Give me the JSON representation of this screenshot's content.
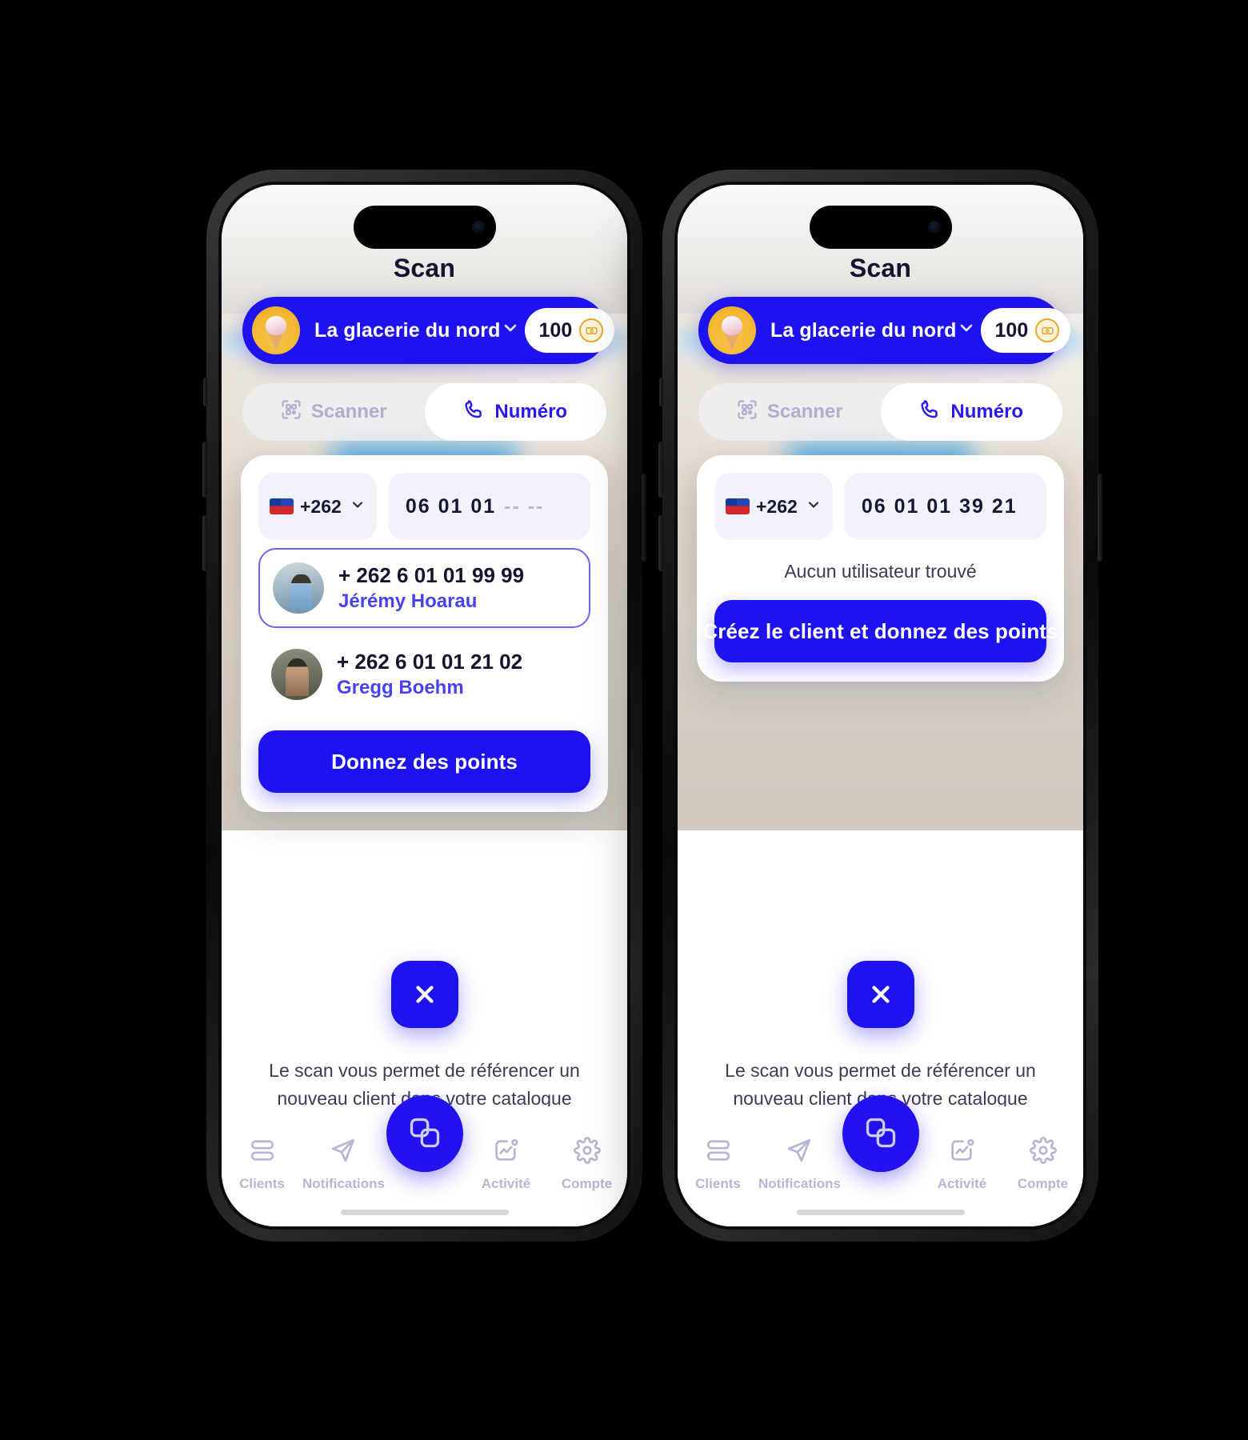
{
  "app": {
    "title": "Scan",
    "accent_color": "#1f12f0",
    "accent_text_color": "#4b42ef",
    "muted_color": "#b4b6d2",
    "coin_color": "#e7a928"
  },
  "merchant": {
    "name": "La glacerie du nord",
    "avatar_name": "ice-cream-avatar",
    "caret_icon": "chevron-down-icon",
    "points_value": "100",
    "points_icon": "coin-icon"
  },
  "tabs": [
    {
      "label": "Scanner",
      "icon": "qr-code-icon",
      "active": false
    },
    {
      "label": "Numéro",
      "icon": "phone-icon",
      "active": true
    }
  ],
  "country": {
    "flag_icon": "reunion-flag-icon",
    "dial_code": "+262",
    "caret_icon": "chevron-down-icon"
  },
  "left_phone": {
    "phone_input": {
      "value": "06 01 01",
      "placeholder": "-- --"
    },
    "results": [
      {
        "phone": "+ 262 6 01 01 99 99",
        "name": "Jérémy Hoarau",
        "avatar_name": "contact-avatar-jeremy",
        "selected": true
      },
      {
        "phone": "+ 262 6 01 01 21 02",
        "name": "Gregg Boehm",
        "avatar_name": "contact-avatar-gregg",
        "selected": false
      }
    ],
    "primary_button": "Donnez des points"
  },
  "right_phone": {
    "phone_input": {
      "value": "06 01 01 39 21",
      "placeholder": ""
    },
    "empty_state": "Aucun utilisateur trouvé",
    "primary_button": "Créez le client et donnez des points"
  },
  "close_button": {
    "icon": "close-icon",
    "label": "Fermer"
  },
  "description": "Le scan vous permet de référencer un nouveau client dans votre catalogue client afin de pouvoir lui envoyer des notifications push",
  "bottom_nav": {
    "items": [
      {
        "label": "Clients",
        "icon": "list-icon"
      },
      {
        "label": "Notifications",
        "icon": "send-icon"
      },
      {
        "label": "Activité",
        "icon": "activity-chart-icon"
      },
      {
        "label": "Compte",
        "icon": "gear-icon"
      }
    ],
    "fab_icon": "scan-icon"
  }
}
